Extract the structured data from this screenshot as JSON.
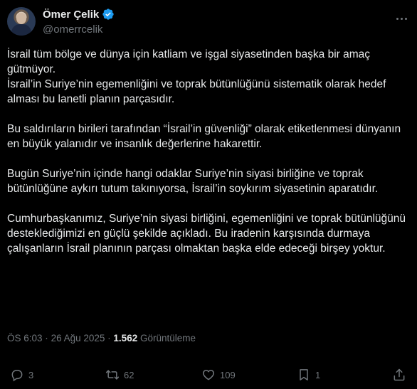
{
  "author": {
    "name": "Ömer Çelik",
    "handle": "@omerrcelik"
  },
  "icons": {
    "avatar": "profile-photo",
    "verified": "verified-badge-icon",
    "more": "more-options-icon",
    "reply": "reply-icon",
    "repost": "repost-icon",
    "like": "like-icon",
    "bookmark": "bookmark-icon",
    "share": "share-icon"
  },
  "colors": {
    "background": "#000000",
    "text": "#e7e9ea",
    "muted": "#71767b",
    "verified": "#1d9bf0"
  },
  "post": {
    "paragraphs": [
      "İsrail tüm bölge ve dünya için katliam ve işgal siyasetinden başka bir amaç gütmüyor.\nİsrail’in Suriye’nin egemenliğini ve toprak bütünlüğünü sistematik olarak hedef alması bu lanetli planın parçasıdır.",
      "Bu saldırıların birileri tarafından “İsrail’in güvenliği” olarak etiketlenmesi dünyanın en büyük yalanıdır ve insanlık değerlerine hakarettir.",
      "Bugün Suriye’nin içinde hangi odaklar Suriye’nin siyasi birliğine ve toprak bütünlüğüne aykırı tutum takınıyorsa, İsrail’in soykırım siyasetinin aparatıdır.",
      "Cumhurbaşkanımız, Suriye’nin siyasi birliğini, egemenliğini ve toprak bütünlüğünü desteklediğimizi en güçlü şekilde açıkladı. Bu iradenin karşısında durmaya çalışanların İsrail planının parçası olmaktan başka elde edeceği birşey yoktur."
    ],
    "time": "ÖS 6:03",
    "separator": "·",
    "date": "26 Ağu 2025",
    "views_count": "1.562",
    "views_label": "Görüntüleme"
  },
  "actions": {
    "replies": "3",
    "reposts": "62",
    "likes": "109",
    "bookmarks": "1"
  }
}
